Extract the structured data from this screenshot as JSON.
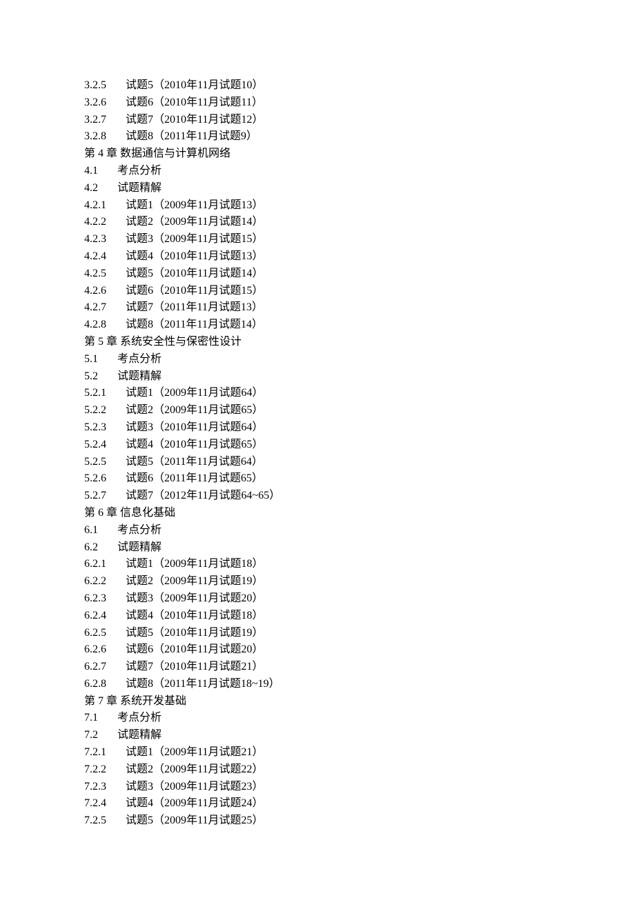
{
  "lines": [
    {
      "num": "3.2.5 ",
      "text": "试题5（2010年11月试题10）"
    },
    {
      "num": "3.2.6 ",
      "text": "试题6（2010年11月试题11）"
    },
    {
      "num": "3.2.7 ",
      "text": "试题7（2010年11月试题12）"
    },
    {
      "num": "3.2.8 ",
      "text": "试题8（2011年11月试题9）"
    },
    {
      "heading": "第 4 章 数据通信与计算机网络"
    },
    {
      "num": "4.1 ",
      "text": "考点分析",
      "short": true
    },
    {
      "num": "4.2 ",
      "text": "试题精解",
      "short": true
    },
    {
      "num": "4.2.1 ",
      "text": "试题1（2009年11月试题13）"
    },
    {
      "num": "4.2.2 ",
      "text": "试题2（2009年11月试题14）"
    },
    {
      "num": "4.2.3 ",
      "text": "试题3（2009年11月试题15）"
    },
    {
      "num": "4.2.4 ",
      "text": "试题4（2010年11月试题13）"
    },
    {
      "num": "4.2.5 ",
      "text": "试题5（2010年11月试题14）"
    },
    {
      "num": "4.2.6 ",
      "text": "试题6（2010年11月试题15）"
    },
    {
      "num": "4.2.7 ",
      "text": "试题7（2011年11月试题13）"
    },
    {
      "num": "4.2.8 ",
      "text": "试题8（2011年11月试题14）"
    },
    {
      "heading": "第 5 章 系统安全性与保密性设计"
    },
    {
      "num": "5.1 ",
      "text": "考点分析",
      "short": true
    },
    {
      "num": "5.2 ",
      "text": "试题精解",
      "short": true
    },
    {
      "num": "5.2.1 ",
      "text": "试题1（2009年11月试题64）"
    },
    {
      "num": "5.2.2 ",
      "text": "试题2（2009年11月试题65）"
    },
    {
      "num": "5.2.3 ",
      "text": "试题3（2010年11月试题64）"
    },
    {
      "num": "5.2.4 ",
      "text": "试题4（2010年11月试题65）"
    },
    {
      "num": "5.2.5 ",
      "text": "试题5（2011年11月试题64）"
    },
    {
      "num": "5.2.6 ",
      "text": "试题6（2011年11月试题65）"
    },
    {
      "num": "5.2.7 ",
      "text": "试题7（2012年11月试题64~65）"
    },
    {
      "heading": "第 6 章 信息化基础"
    },
    {
      "num": "6.1 ",
      "text": "考点分析",
      "short": true
    },
    {
      "num": "6.2 ",
      "text": "试题精解",
      "short": true
    },
    {
      "num": "6.2.1 ",
      "text": "试题1（2009年11月试题18）"
    },
    {
      "num": "6.2.2 ",
      "text": "试题2（2009年11月试题19）"
    },
    {
      "num": "6.2.3 ",
      "text": "试题3（2009年11月试题20）"
    },
    {
      "num": "6.2.4 ",
      "text": "试题4（2010年11月试题18）"
    },
    {
      "num": "6.2.5 ",
      "text": "试题5（2010年11月试题19）"
    },
    {
      "num": "6.2.6 ",
      "text": "试题6（2010年11月试题20）"
    },
    {
      "num": "6.2.7 ",
      "text": "试题7（2010年11月试题21）"
    },
    {
      "num": "6.2.8 ",
      "text": "试题8（2011年11月试题18~19）"
    },
    {
      "heading": "第 7 章 系统开发基础"
    },
    {
      "num": "7.1 ",
      "text": "考点分析",
      "short": true
    },
    {
      "num": "7.2 ",
      "text": "试题精解",
      "short": true
    },
    {
      "num": "7.2.1 ",
      "text": "试题1（2009年11月试题21）"
    },
    {
      "num": "7.2.2 ",
      "text": "试题2（2009年11月试题22）"
    },
    {
      "num": "7.2.3 ",
      "text": "试题3（2009年11月试题23）"
    },
    {
      "num": "7.2.4 ",
      "text": "试题4（2009年11月试题24）"
    },
    {
      "num": "7.2.5 ",
      "text": "试题5（2009年11月试题25）"
    }
  ]
}
